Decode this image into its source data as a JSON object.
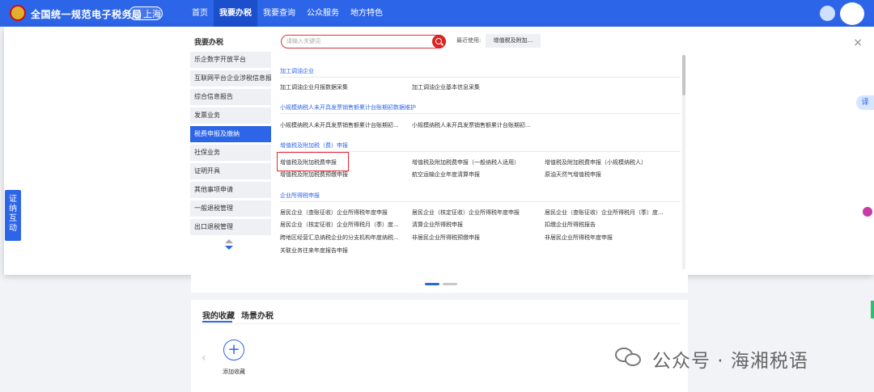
{
  "header": {
    "site_title": "全国统一规范电子税务局",
    "location": "上海",
    "nav": [
      "首页",
      "我要办税",
      "我要查询",
      "公众服务",
      "地方特色"
    ]
  },
  "menu": {
    "heading": "我要办税",
    "items": [
      "乐企数字开放平台",
      "互联网平台企业涉税信息报送",
      "综合信息报告",
      "发票业务",
      "税费申报及缴纳",
      "社保业务",
      "证明开具",
      "其他事项申请",
      "一般退税管理",
      "出口退税管理"
    ]
  },
  "search": {
    "placeholder": "请输入关键词",
    "recent_label": "最近使用:",
    "recent_chip": "增值税及附加..."
  },
  "sections": [
    {
      "title": "加工调油企业",
      "links": [
        "加工调油企业月报数据采集",
        "加工调油企业基本信息采集"
      ]
    },
    {
      "title": "小规模纳税人未开具发票销售额累计台账期初数据维护",
      "links": [
        "小规模纳税人未开具发票销售额累计台账期初...",
        "小规模纳税人未开具发票销售额累计台账期初..."
      ]
    },
    {
      "title": "增值税及附加税（费）申报",
      "links": [
        "增值税及附加税费申报",
        "增值税及附加税费申报（一般纳税人适用）",
        "增值税及附加税费申报（小规模纳税人）",
        "增值税及附加税费预缴申报",
        "航空运输企业年度清算申报",
        "原油天然气增值税申报"
      ]
    },
    {
      "title": "企业所得税申报",
      "links": [
        "居民企业（查账征收）企业所得税年度申报",
        "居民企业（核定征收）企业所得税年度申报",
        "居民企业（查账征收）企业所得税月（季）度...",
        "居民企业（核定征收）企业所得税月（季）度...",
        "清算企业所得税申报",
        "扣缴企业所得税报告",
        "跨地区经营汇总纳税企业的分支机构年度纳税...",
        "非居民企业所得税预缴申报",
        "非居民企业所得税年度申报",
        "关联业务往来年度报告申报"
      ]
    }
  ],
  "side_tab": [
    "证",
    "纳",
    "互",
    "动"
  ],
  "translate_label": "译",
  "favorites": {
    "tab_fav": "我的收藏",
    "tab_scene": "场景办税",
    "add_label": "添加收藏",
    "add_symbol": "+",
    "prev_symbol": "‹"
  },
  "watermark": "公众号 · 海湘税语",
  "close_symbol": "×"
}
